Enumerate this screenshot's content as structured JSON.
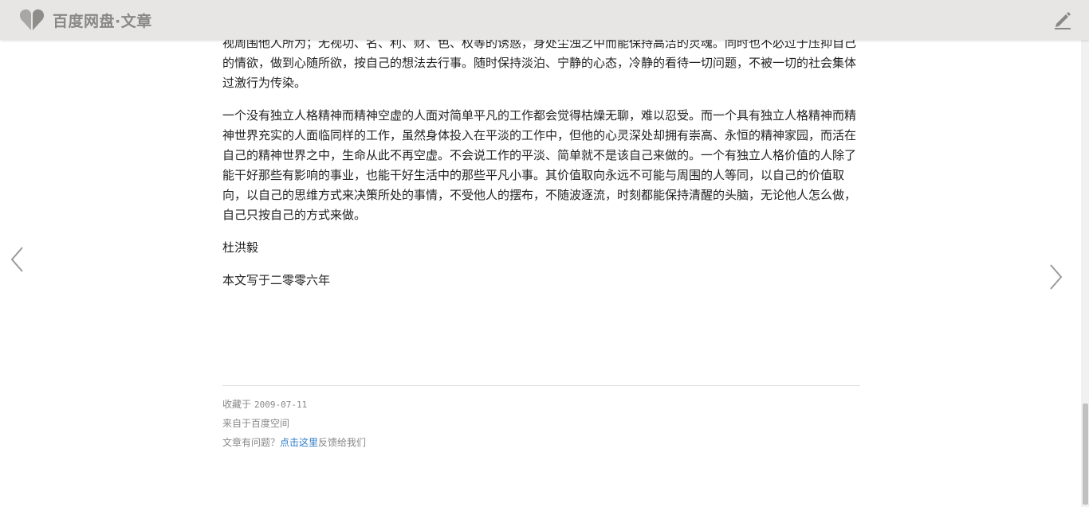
{
  "header": {
    "brand": "百度网盘·文章"
  },
  "article": {
    "paragraphs": [
      "视周围他人所为；无视功、名、利、财、色、权等的诱惑，身处尘浊之中而能保持高洁的灵魂。同时也不必过于压抑自己的情欲，做到心随所欲，按自己的想法去行事。随时保持淡泊、宁静的心态，冷静的看待一切问题，不被一切的社会集体过激行为传染。",
      "一个没有独立人格精神而精神空虚的人面对简单平凡的工作都会觉得枯燥无聊，难以忍受。而一个具有独立人格精神而精神世界充实的人面临同样的工作，虽然身体投入在平淡的工作中，但他的心灵深处却拥有崇高、永恒的精神家园，而活在自己的精神世界之中，生命从此不再空虚。不会说工作的平淡、简单就不是该自己来做的。一个有独立人格价值的人除了能干好那些有影响的事业，也能干好生活中的那些平凡小事。其价值取向永远不可能与周围的人等同，以自己的价值取向，以自己的思维方式来决策所处的事情，不受他人的摆布，不随波逐流，时刻都能保持清醒的头脑，无论他人怎么做，自己只按自己的方式来做。",
      "杜洪毅",
      "本文写于二零零六年"
    ]
  },
  "footer": {
    "saved_label": "收藏于",
    "saved_date": "2009-07-11",
    "source": "来自于百度空间",
    "feedback_prefix": "文章有问题？",
    "feedback_link": "点击这里",
    "feedback_suffix": "反馈给我们"
  },
  "icons": {
    "logo": "heart-logo-icon",
    "edit": "pencil-icon",
    "prev": "chevron-left-icon",
    "next": "chevron-right-icon"
  },
  "colors": {
    "header_bg": "#e7e6e4",
    "link": "#2d7ac4"
  }
}
